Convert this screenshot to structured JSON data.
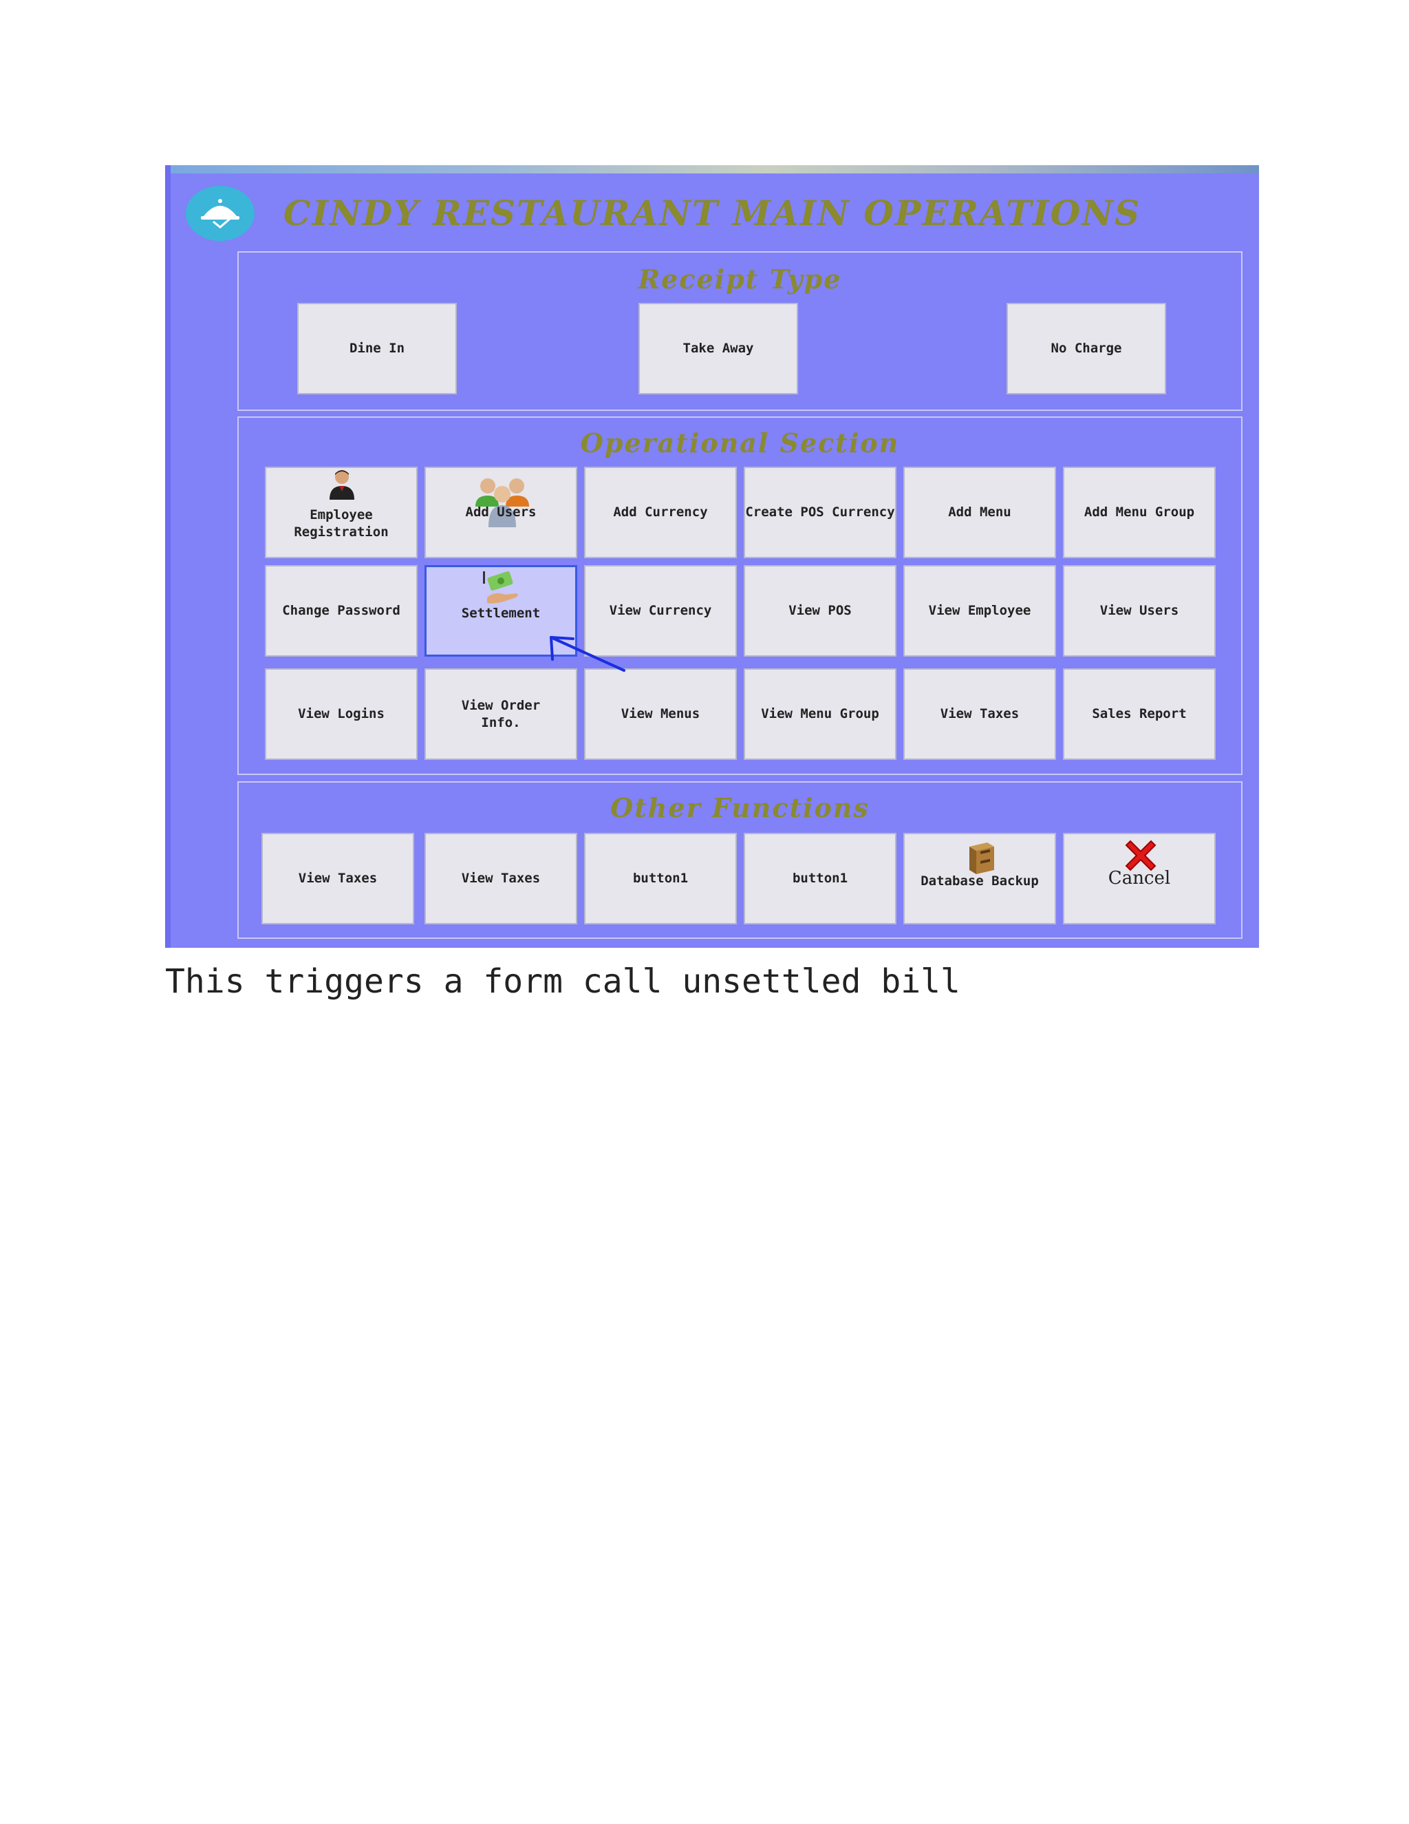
{
  "window_title": "CINDY RESTAURANT MAIN OPERATIONS",
  "receipt_type": {
    "title": "Receipt Type",
    "buttons": [
      "Dine In",
      "Take Away",
      "No Charge"
    ]
  },
  "operational": {
    "title": "Operational Section",
    "row1": [
      "Employee Registration",
      "Add Users",
      "Add Currency",
      "Create POS Currency",
      "Add Menu",
      "Add Menu Group"
    ],
    "row2": [
      "Change Password",
      "Settlement",
      "View Currency",
      "View POS",
      "View Employee",
      "View Users"
    ],
    "row3": [
      "View Logins",
      "View Order Info.",
      "View Menus",
      "View Menu Group",
      "View Taxes",
      "Sales Report"
    ]
  },
  "other": {
    "title": "Other Functions",
    "buttons": [
      "View Taxes",
      "View Taxes",
      "button1",
      "button1",
      "Database Backup",
      "Cancel"
    ]
  },
  "caption": "This triggers a form call unsettled bill",
  "colors": {
    "window_bg": "#8181f8",
    "title": "#8a8a2e",
    "button": "#e6e6ec",
    "selected": "#c8c8fa",
    "arrow": "#1a2ee0"
  },
  "icons": {
    "logo": "cloche-icon",
    "employee": "person-icon",
    "users": "group-icon",
    "settlement": "money-hand-icon",
    "backup": "cabinet-icon",
    "cancel": "red-x-icon"
  }
}
